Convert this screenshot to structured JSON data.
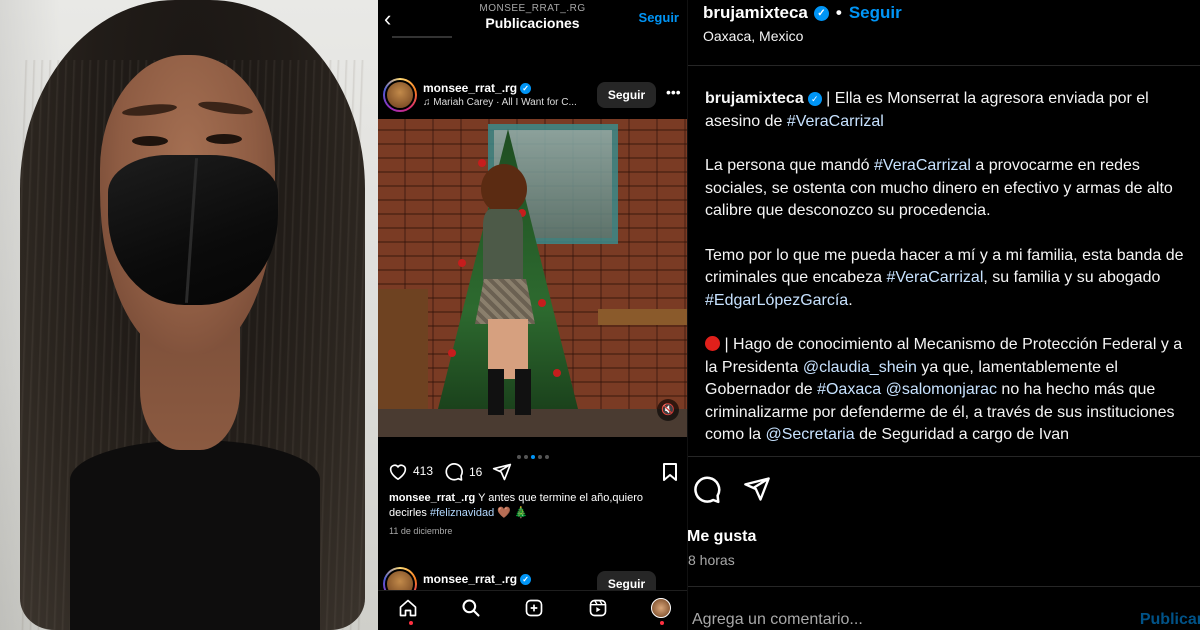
{
  "mobile": {
    "header": {
      "subtitle": "MONSEE_RRAT_.RG",
      "title": "Publicaciones",
      "follow_label": "Seguir"
    },
    "post": {
      "username": "monsee_rrat_.rg",
      "song": "♫ Mariah Carey · All I Want for C...",
      "follow_label": "Seguir",
      "likes": "413",
      "comments": "16",
      "caption_user": "monsee_rrat_.rg",
      "caption_text": "Y antes que termine el año,quiero decirles",
      "caption_hashtag": "#feliznavidad",
      "caption_emoji": "🤎 🎄",
      "date": "11 de diciembre"
    },
    "next_post": {
      "username": "monsee_rrat_.rg",
      "follow_label": "Seguir"
    },
    "colors": {
      "accent": "#0095f6",
      "background": "#000000"
    }
  },
  "desktop": {
    "header": {
      "username": "brujamixteca",
      "follow_label": "Seguir",
      "location": "Oaxaca, Mexico"
    },
    "caption": {
      "username": "brujamixteca",
      "p1_text": " | Ella es Monserrat la agresora enviada por el asesino de ",
      "p1_tag": "#VeraCarrizal",
      "p2_a": "La persona que mandó ",
      "p2_tag": "#VeraCarrizal",
      "p2_b": " a provocarme en redes sociales, se ostenta con mucho dinero en efectivo y armas de alto calibre que desconozco su procedencia.",
      "p3_a": "Temo por lo que me pueda hacer a mí y a mi familia, esta banda de criminales que encabeza ",
      "p3_tag1": "#VeraCarrizal",
      "p3_b": ", su familia y su abogado ",
      "p3_tag2": "#EdgarLópezGarcía",
      "p3_c": ".",
      "p4_a": " | Hago de conocimiento al Mecanismo de Protección Federal y a la Presidenta ",
      "p4_tag1": "@claudia_shein",
      "p4_b": " ya que, lamentablemente el Gobernador de ",
      "p4_tag2": "#Oaxaca",
      "p4_c": " ",
      "p4_tag3": "@salomonjarac",
      "p4_d": " no ha hecho más que criminalizarme por defenderme de él, a través de sus instituciones como la ",
      "p4_tag4": "@Secretaria",
      "p4_e": " de Seguridad a cargo de Ivan"
    },
    "likes_label": "Me gusta",
    "time": "8 horas",
    "comment_placeholder": "Agrega un comentario...",
    "publish_label": "Publicar"
  }
}
